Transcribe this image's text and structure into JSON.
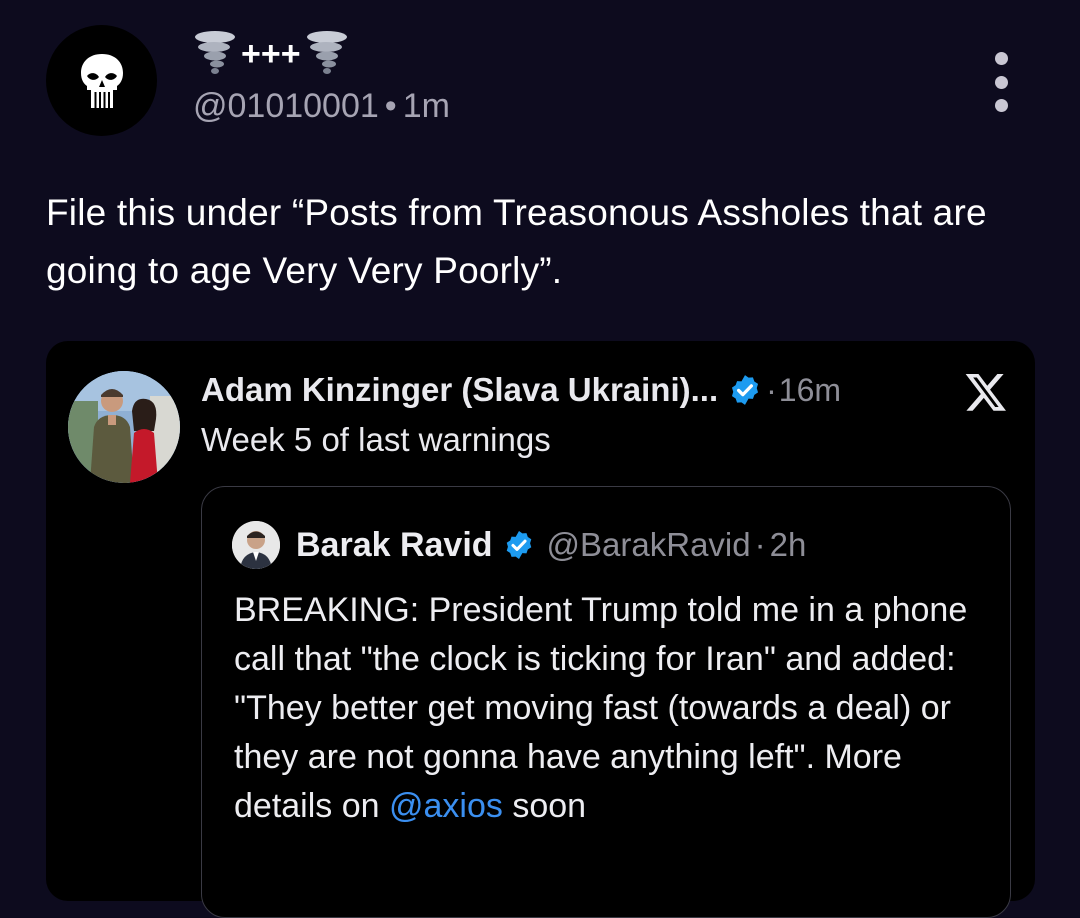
{
  "post": {
    "display_name_text": "+++",
    "handle": "@01010001",
    "separator": "•",
    "time": "1m",
    "text": "File this under “Posts from Treasonous Assholes that are going to age Very Very Poorly”.",
    "icons": {
      "avatar": "punisher-skull-icon",
      "name_left": "tornado-icon",
      "name_right": "tornado-icon",
      "more": "more-vertical-icon"
    }
  },
  "embed": {
    "author_name": "Adam Kinzinger (Slava Ukraini)...",
    "separator": "·",
    "time": "16m",
    "text": "Week 5 of last warnings",
    "icons": {
      "verified": "verified-badge-icon",
      "platform": "x-logo-icon"
    },
    "quote": {
      "author_name": "Barak Ravid",
      "handle": "@BarakRavid",
      "separator": "·",
      "time": "2h",
      "text_before": "BREAKING: President Trump told me in a phone call that \"the clock is ticking for Iran\" and added: \"They better get moving fast (towards a deal) or they are not gonna have anything left\". More details on",
      "mention": "@axios",
      "text_after": "soon"
    }
  },
  "colors": {
    "background": "#0d0b1e",
    "card": "#000000",
    "link": "#3b8ff0",
    "verified": "#1d9bf0",
    "muted": "#a6a4b3"
  }
}
